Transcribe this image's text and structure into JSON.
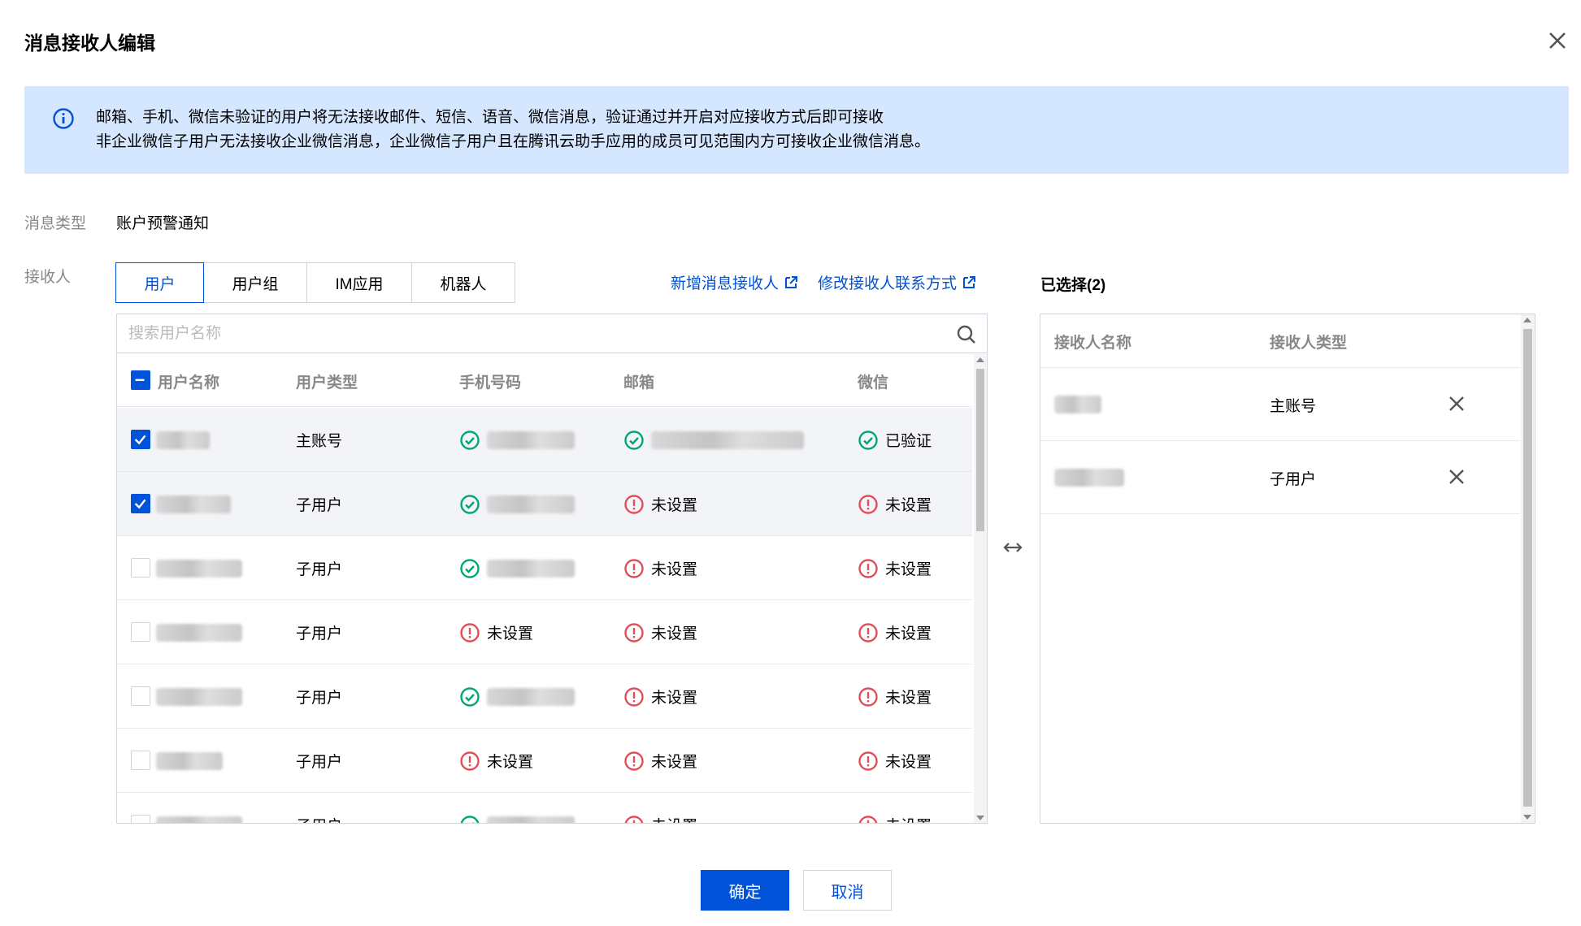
{
  "dialog": {
    "title": "消息接收人编辑"
  },
  "notice": {
    "line1": "邮箱、手机、微信未验证的用户将无法接收邮件、短信、语音、微信消息，验证通过并开启对应接收方式后即可接收",
    "line2": "非企业微信子用户无法接收企业微信消息，企业微信子用户且在腾讯云助手应用的成员可见范围内方可接收企业微信消息。"
  },
  "form": {
    "msg_type_label": "消息类型",
    "msg_type_value": "账户预警通知",
    "receiver_label": "接收人"
  },
  "tabs": [
    {
      "label": "用户",
      "active": true
    },
    {
      "label": "用户组",
      "active": false
    },
    {
      "label": "IM应用",
      "active": false
    },
    {
      "label": "机器人",
      "active": false
    }
  ],
  "links": {
    "add_receiver": "新增消息接收人",
    "edit_contact": "修改接收人联系方式"
  },
  "search": {
    "placeholder": "搜索用户名称"
  },
  "table": {
    "columns": [
      "用户名称",
      "用户类型",
      "手机号码",
      "邮箱",
      "微信"
    ],
    "rows": [
      {
        "checked": true,
        "type": "主账号",
        "phone": "verified",
        "email": "verified",
        "wechat": "verified",
        "wechat_text": "已验证",
        "phone_text": "",
        "email_text": ""
      },
      {
        "checked": true,
        "type": "子用户",
        "phone": "verified",
        "email": "unset",
        "wechat": "unset",
        "email_text": "未设置",
        "wechat_text": "未设置",
        "phone_text": ""
      },
      {
        "checked": false,
        "type": "子用户",
        "phone": "verified",
        "email": "unset",
        "wechat": "unset",
        "email_text": "未设置",
        "wechat_text": "未设置",
        "phone_text": ""
      },
      {
        "checked": false,
        "type": "子用户",
        "phone": "unset",
        "email": "unset",
        "wechat": "unset",
        "phone_text": "未设置",
        "email_text": "未设置",
        "wechat_text": "未设置"
      },
      {
        "checked": false,
        "type": "子用户",
        "phone": "verified",
        "email": "unset",
        "wechat": "unset",
        "email_text": "未设置",
        "wechat_text": "未设置",
        "phone_text": ""
      },
      {
        "checked": false,
        "type": "子用户",
        "phone": "unset",
        "email": "unset",
        "wechat": "unset",
        "phone_text": "未设置",
        "email_text": "未设置",
        "wechat_text": "未设置"
      },
      {
        "checked": false,
        "type": "子用户",
        "phone": "verified",
        "email": "unset",
        "wechat": "unset",
        "email_text": "未设置",
        "wechat_text": "未设置",
        "phone_text": ""
      }
    ]
  },
  "selected": {
    "title": "已选择(2)",
    "columns": [
      "接收人名称",
      "接收人类型"
    ],
    "rows": [
      {
        "type": "主账号"
      },
      {
        "type": "子用户"
      }
    ]
  },
  "buttons": {
    "confirm": "确定",
    "cancel": "取消"
  },
  "colors": {
    "primary": "#0052d9",
    "success": "#00a870",
    "error": "#e34d59",
    "notice_bg": "#d5e7ff"
  }
}
